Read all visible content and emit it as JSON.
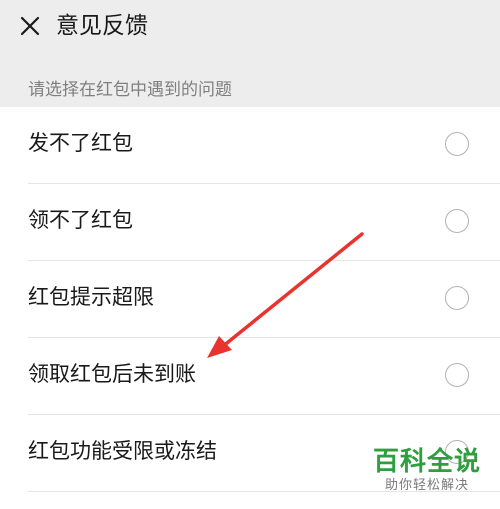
{
  "header": {
    "title": "意见反馈",
    "close_icon": "close-icon"
  },
  "section": {
    "label": "请选择在红包中遇到的问题"
  },
  "options": [
    {
      "label": "发不了红包",
      "selected": false
    },
    {
      "label": "领不了红包",
      "selected": false
    },
    {
      "label": "红包提示超限",
      "selected": false
    },
    {
      "label": "领取红包后未到账",
      "selected": false
    },
    {
      "label": "红包功能受限或冻结",
      "selected": false
    }
  ],
  "colors": {
    "background": "#ededed",
    "list_background": "#ffffff",
    "text": "#191919",
    "secondary_text": "#7f7f7f",
    "annotation_arrow": "#e8332e",
    "watermark_green": "#2e9e3e"
  },
  "watermark": {
    "main": "百科全说",
    "sub": "助你轻松解决"
  }
}
